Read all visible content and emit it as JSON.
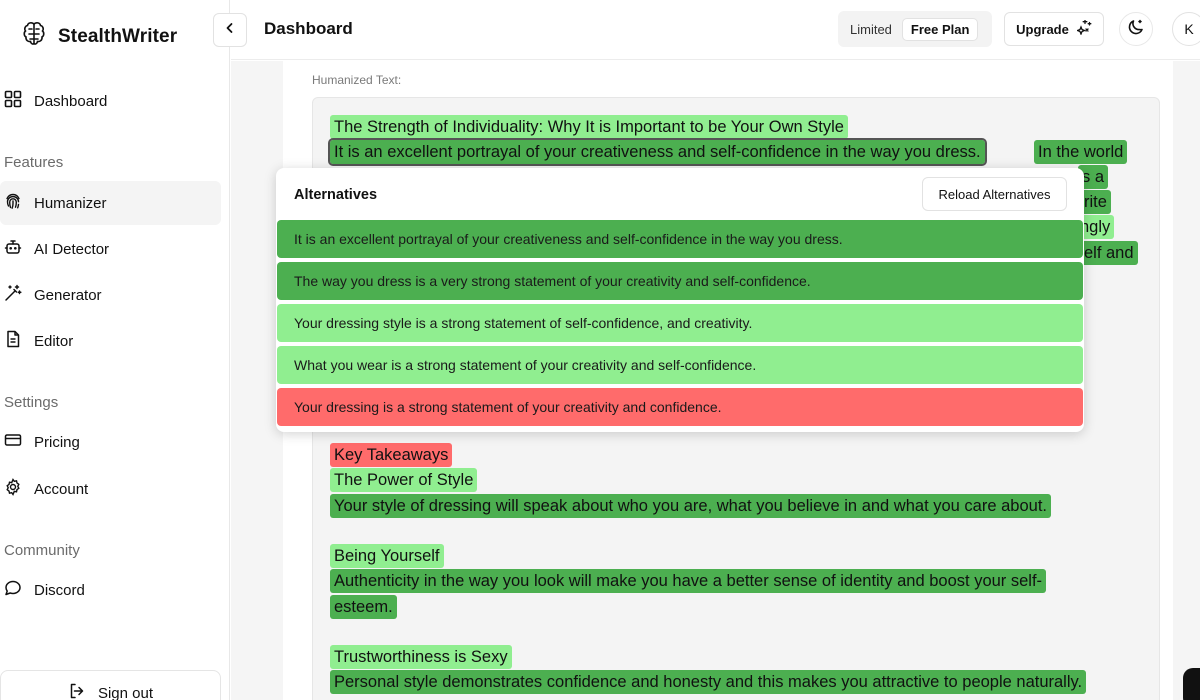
{
  "app": {
    "name": "StealthWriter",
    "page_title": "Dashboard"
  },
  "sidebar": {
    "items": [
      {
        "label": "Dashboard",
        "icon": "dashboard-grid-icon"
      },
      {
        "label": "Humanizer",
        "icon": "fingerprint-icon",
        "active": true
      },
      {
        "label": "AI Detector",
        "icon": "bot-icon"
      },
      {
        "label": "Generator",
        "icon": "magic-wand-icon"
      },
      {
        "label": "Editor",
        "icon": "document-icon"
      },
      {
        "label": "Pricing",
        "icon": "credit-card-icon"
      },
      {
        "label": "Account",
        "icon": "gear-icon"
      },
      {
        "label": "Discord",
        "icon": "chat-bubble-icon"
      }
    ],
    "sections": {
      "features": "Features",
      "settings": "Settings",
      "community": "Community"
    },
    "sign_out": "Sign out"
  },
  "header": {
    "plan_label": "Limited",
    "plan_badge": "Free Plan",
    "upgrade": "Upgrade",
    "avatar_initial": "K"
  },
  "output": {
    "label": "Humanized Text:",
    "segments": [
      {
        "text": "The Strength of Individuality: Why It is Important to be Your Own Style",
        "tone": "light"
      },
      {
        "text": "It is an excellent portrayal of your creativeness and self-confidence in the way you dress.",
        "tone": "dark",
        "selected": true
      },
      {
        "text": "In the world",
        "tone": "dark"
      },
      {
        "text": "s a",
        "tone": "dark"
      },
      {
        "text": "rite",
        "tone": "dark"
      },
      {
        "text": "ngly",
        "tone": "light"
      },
      {
        "text": "elf and",
        "tone": "dark"
      },
      {
        "text": "Key Takeaways",
        "tone": "red"
      },
      {
        "text": "The Power of Style",
        "tone": "light"
      },
      {
        "text": "Your style of dressing will speak about who you are, what you believe in and what you care about.",
        "tone": "dark"
      },
      {
        "text": "Being Yourself",
        "tone": "light"
      },
      {
        "text": "Authenticity in the way you look will make you have a better sense of identity and boost your self-",
        "tone": "dark"
      },
      {
        "text": "esteem.",
        "tone": "dark"
      },
      {
        "text": "Trustworthiness is Sexy",
        "tone": "light"
      },
      {
        "text": "Personal style demonstrates confidence and honesty and this makes you attractive to people naturally.",
        "tone": "dark"
      }
    ]
  },
  "alternatives": {
    "title": "Alternatives",
    "reload": "Reload Alternatives",
    "options": [
      {
        "text": "It is an excellent portrayal of your creativeness and self-confidence in the way you dress.",
        "tone": "dark"
      },
      {
        "text": "The way you dress is a very strong statement of your creativity and self-confidence.",
        "tone": "dark"
      },
      {
        "text": "Your dressing style is a strong statement of self-confidence, and creativity.",
        "tone": "light"
      },
      {
        "text": "What you wear is a strong statement of your creativity and self-confidence.",
        "tone": "light"
      },
      {
        "text": "Your dressing is a strong statement of your creativity and confidence.",
        "tone": "red"
      }
    ]
  },
  "colors": {
    "light_green": "#90ee90",
    "dark_green": "#4caf50",
    "red": "#ff6b6b"
  }
}
